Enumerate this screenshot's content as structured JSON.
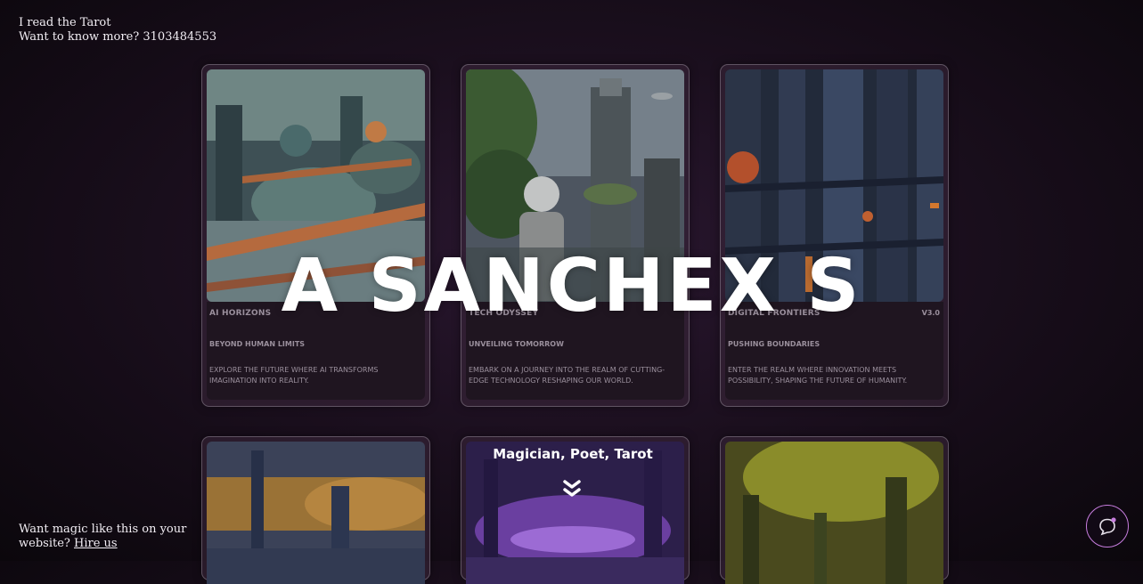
{
  "header": {
    "line1": "I read the Tarot",
    "line2": "Want to know more? 3103484553"
  },
  "hero": {
    "title": "A SANCHEX S",
    "tagline": "Magician, Poet, Tarot"
  },
  "cards": [
    {
      "title": "AI Horizons",
      "version": "",
      "subtitle": "Beyond Human Limits",
      "description": "Explore the future where AI transforms imagination into reality."
    },
    {
      "title": "Tech Odyssey",
      "version": "",
      "subtitle": "Unveiling Tomorrow",
      "description": "Embark on a journey into the realm of cutting-edge technology reshaping our world."
    },
    {
      "title": "Digital Frontiers",
      "version": "V3.0",
      "subtitle": "Pushing Boundaries",
      "description": "Enter the realm where innovation meets possibility, shaping the future of humanity."
    }
  ],
  "footer": {
    "text": "Want magic like this on your website?",
    "link": "Hire us"
  },
  "icons": {
    "scroll": "chevron-double-down-icon",
    "chat": "chat-bubble-icon"
  },
  "colors": {
    "background": "#1b0f1e",
    "accent": "#c77dde"
  }
}
